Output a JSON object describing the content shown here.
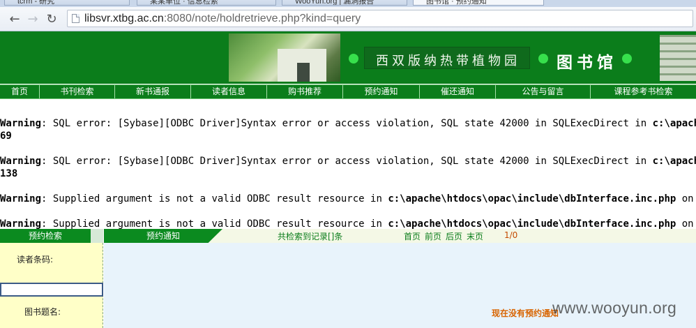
{
  "browser": {
    "tabs": [
      {
        "title": "tcrm - 研究"
      },
      {
        "title": "某某单位 · 信息检索"
      },
      {
        "title": "WooYun.org | 漏洞报告"
      },
      {
        "title": "图书馆 · 预约通知"
      }
    ],
    "url_host": "libsvr.xtbg.ac.cn",
    "url_rest": ":8080/note/holdretrieve.php?kind=query",
    "back_icon": "arrow-left-icon",
    "forward_icon": "arrow-right-icon",
    "reload_icon": "reload-icon"
  },
  "header": {
    "site_name": "西双版纳热带植物园",
    "library_name": "图书馆"
  },
  "nav": {
    "items": [
      {
        "label": "首页"
      },
      {
        "label": "书刊检索"
      },
      {
        "label": "新书通报"
      },
      {
        "label": "读者信息"
      },
      {
        "label": "购书推荐"
      },
      {
        "label": "预约通知"
      },
      {
        "label": "催还通知"
      },
      {
        "label": "公告与留言"
      },
      {
        "label": "课程参考书检索"
      }
    ]
  },
  "warnings": [
    {
      "prefix": "Warning",
      "text": ": SQL error: [Sybase][ODBC Driver]Syntax error or access violation, SQL state 42000 in SQLExecDirect in ",
      "path": "c:\\apache\\htd",
      "line": "69"
    },
    {
      "prefix": "Warning",
      "text": ": SQL error: [Sybase][ODBC Driver]Syntax error or access violation, SQL state 42000 in SQLExecDirect in ",
      "path": "c:\\apache\\htd",
      "line": "138"
    },
    {
      "prefix": "Warning",
      "text": ": Supplied argument is not a valid ODBC result resource in ",
      "path": "c:\\apache\\htdocs\\opac\\include\\dbInterface.inc.php",
      "tail": " on line"
    },
    {
      "prefix": "Warning",
      "text": ": Supplied argument is not a valid ODBC result resource in ",
      "path": "c:\\apache\\htdocs\\opac\\include\\dbInterface.inc.php",
      "tail": " on line"
    }
  ],
  "left_panel": {
    "title": "预约检索",
    "reader_barcode_label": "读者条码:",
    "reader_barcode_value": "",
    "book_title_label": "图书题名:"
  },
  "right_panel": {
    "tab_label": "预约通知",
    "result_count": "共检索到记录[]条",
    "pager": {
      "first": "首页",
      "prev": "前页",
      "next": "后页",
      "last": "末页"
    },
    "page_indicator": "1/0",
    "empty_message": "现在没有预约通知"
  },
  "watermark": "www.wooyun.org",
  "colors": {
    "brand_green": "#0b7d1b",
    "panel_yellow": "#ffffc8",
    "panel_blue": "#e8f3fb",
    "notice_orange": "#d86400"
  }
}
